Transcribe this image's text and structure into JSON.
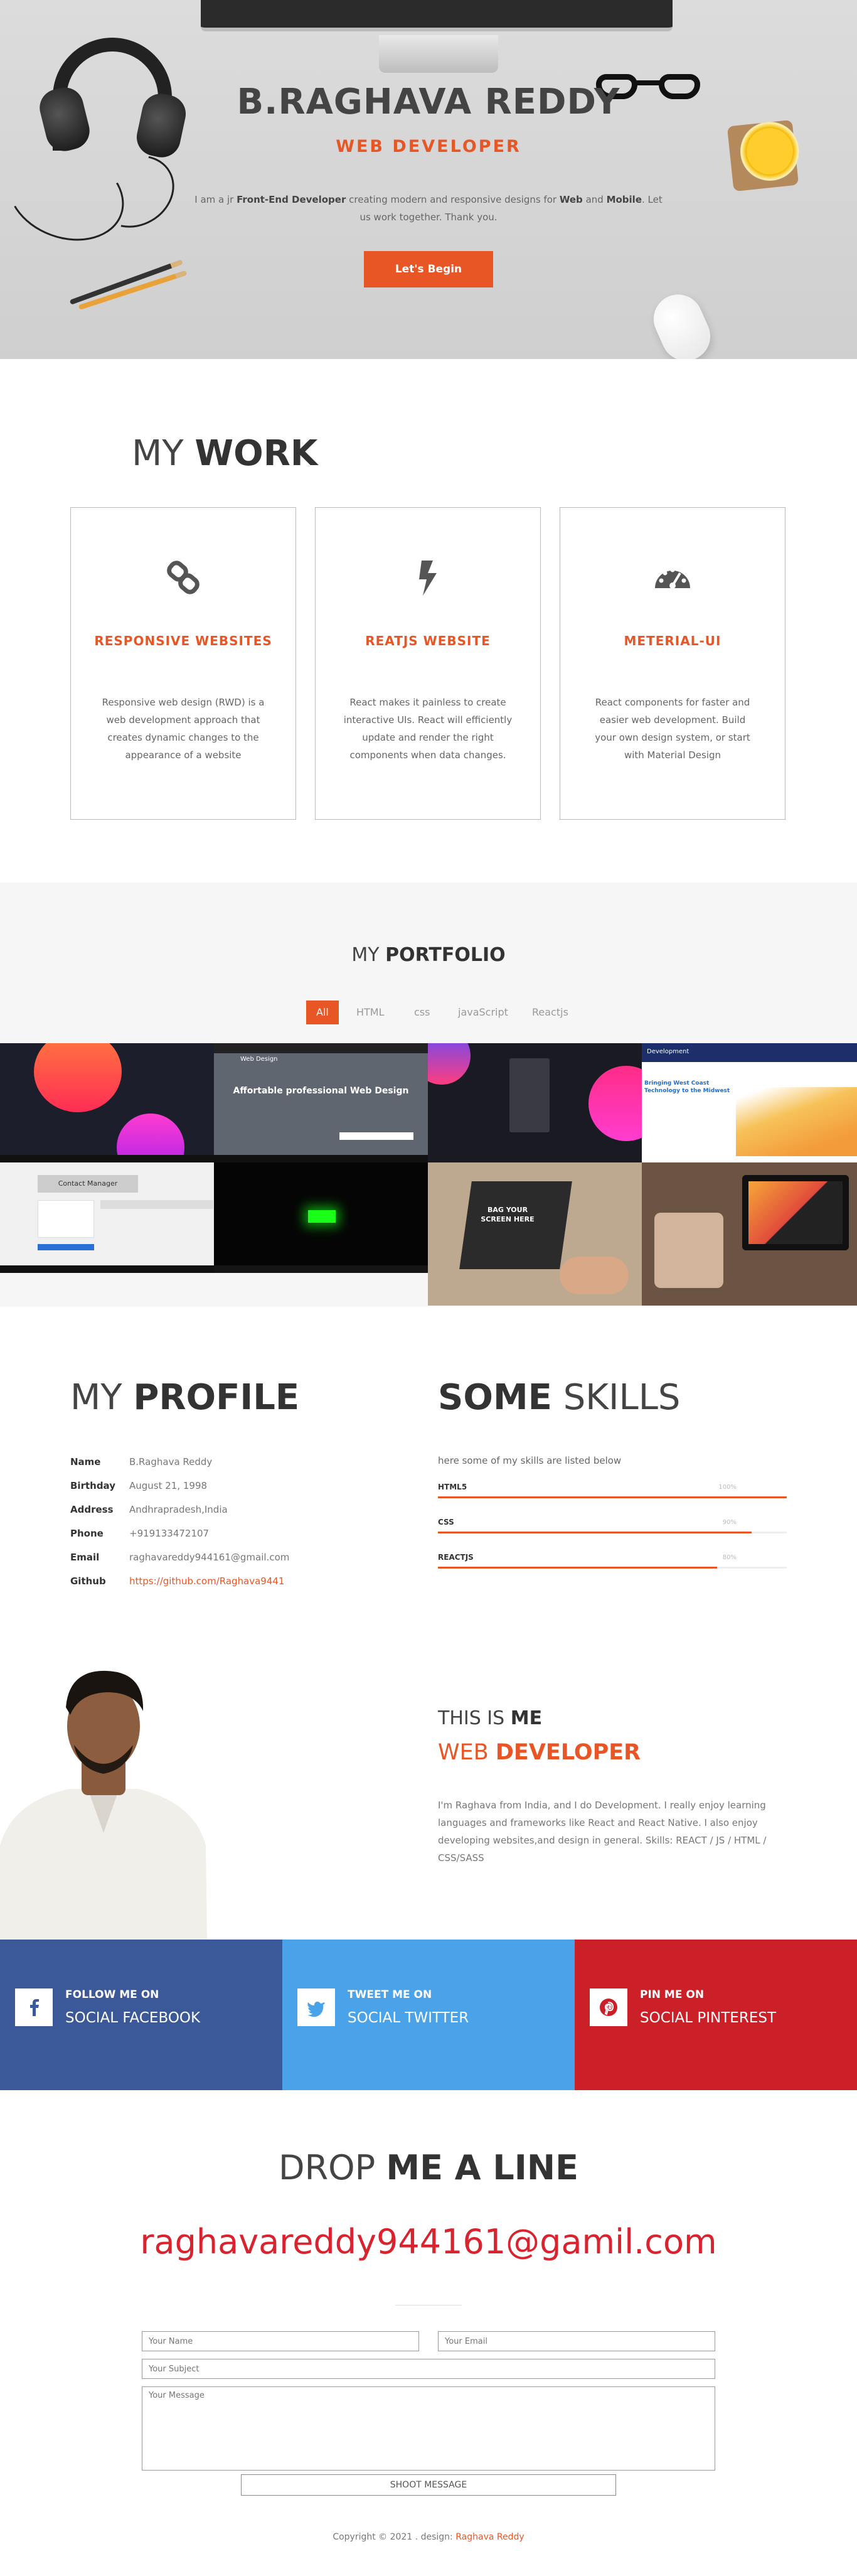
{
  "hero": {
    "name": "B.RAGHAVA REDDY",
    "role": "WEB DEVELOPER",
    "desc_1": "I am a jr ",
    "desc_b1": "Front-End Developer",
    "desc_2": " creating modern and responsive designs for ",
    "desc_b2": "Web",
    "desc_3": " and ",
    "desc_b3": "Mobile",
    "desc_4": ". Let us work together. Thank you.",
    "cta": "Let's Begin"
  },
  "work": {
    "title_light": "MY ",
    "title_bold": "WORK",
    "cards": [
      {
        "icon": "link-icon",
        "title": "RESPONSIVE WEBSITES",
        "text": "Responsive web design (RWD) is a web development approach that creates dynamic changes to the appearance of a website"
      },
      {
        "icon": "bolt-icon",
        "title": "REATJS WEBSITE",
        "text": "React makes it painless to create interactive UIs. React will efficiently update and render the right components when data changes."
      },
      {
        "icon": "dashboard-icon",
        "title": "METERIAL-UI",
        "text": "React components for faster and easier web development. Build your own design system, or start with Material Design"
      }
    ]
  },
  "portfolio": {
    "title_light": "MY ",
    "title_bold": "PORTFOLIO",
    "filters": [
      "All",
      "HTML",
      "css",
      "javaScript",
      "Reactjs"
    ],
    "thumb_web_design_title": "Affortable professional Web Design",
    "thumb_web_design_brand": "Web Design",
    "thumb_dev_brand": "Development",
    "thumb_dev_headline": "Bringing West Coast Technology to the Midwest",
    "thumb_contact": "Contact Manager",
    "thumb_bag_text": "BAG YOUR SCREEN HERE"
  },
  "profile": {
    "title_light": "MY ",
    "title_bold": "PROFILE",
    "rows": [
      {
        "key": "Name",
        "value": "B.Raghava Reddy"
      },
      {
        "key": "Birthday",
        "value": "August 21, 1998"
      },
      {
        "key": "Address",
        "value": "Andhrapradesh,India"
      },
      {
        "key": "Phone",
        "value": "+919133472107"
      },
      {
        "key": "Email",
        "value": "raghavareddy944161@gmail.com"
      },
      {
        "key": "Github",
        "value": "https://github.com/Raghava9441"
      }
    ]
  },
  "skills": {
    "title_bold": "SOME",
    "title_light": " SKILLS",
    "intro": "here some of my skills are listed below",
    "items": [
      {
        "name": "HTML5",
        "pct_label": "100%",
        "level": 1.0
      },
      {
        "name": "CSS",
        "pct_label": "90%",
        "level": 0.9
      },
      {
        "name": "REACTJS",
        "pct_label": "80%",
        "level": 0.8
      }
    ]
  },
  "about": {
    "pre_light": "THIS IS ",
    "pre_bold": "ME",
    "role_light": "WEB ",
    "role_bold": "DEVELOPER",
    "text": "I'm Raghava from India, and I do Development. I really enjoy learning languages and frameworks like React and React Native. I also enjoy developing websites,and design in general. Skills: REACT / JS / HTML / CSS/SASS"
  },
  "social": [
    {
      "icon": "facebook-icon",
      "line1": "FOLLOW ME ON",
      "line2": "SOCIAL FACEBOOK",
      "color": "#3b5998"
    },
    {
      "icon": "twitter-icon",
      "line1": "TWEET ME ON",
      "line2": "SOCIAL TWITTER",
      "color": "#4aa3e8"
    },
    {
      "icon": "pinterest-icon",
      "line1": "PIN ME ON",
      "line2": "SOCIAL PINTEREST",
      "color": "#cb2027"
    }
  ],
  "contact": {
    "title_light": "DROP ",
    "title_bold": "ME A LINE",
    "email": "raghavareddy944161@gamil.com",
    "name_ph": "Your Name",
    "email_ph": "Your Email",
    "subject_ph": "Your Subject",
    "message_ph": "Your Message",
    "submit": "SHOOT MESSAGE"
  },
  "footer": {
    "text": "Copyright © 2021 . design: ",
    "link": "Raghava Reddy"
  },
  "colors": {
    "accent": "#e95625",
    "email_red": "#d9232e"
  }
}
